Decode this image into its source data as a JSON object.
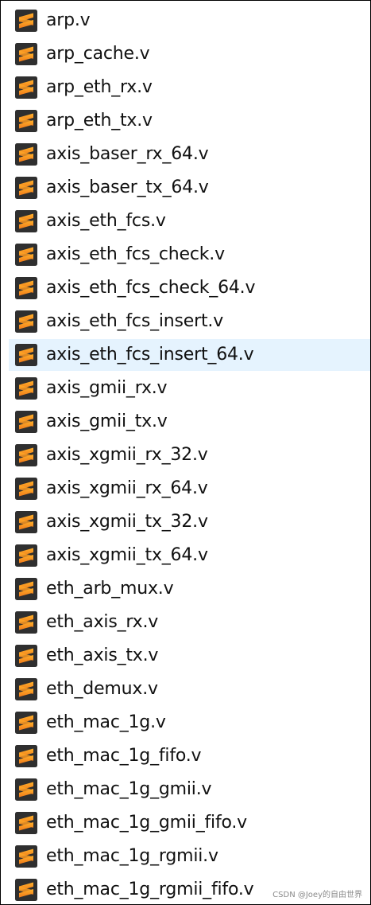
{
  "file_list": {
    "selected_index": 10,
    "icon": "sublime-text-file-icon",
    "icon_colors": {
      "tile": "#2f2f2f",
      "glyph_top": "#ffb12a",
      "glyph_bottom": "#f07a1a"
    },
    "files": [
      "arp.v",
      "arp_cache.v",
      "arp_eth_rx.v",
      "arp_eth_tx.v",
      "axis_baser_rx_64.v",
      "axis_baser_tx_64.v",
      "axis_eth_fcs.v",
      "axis_eth_fcs_check.v",
      "axis_eth_fcs_check_64.v",
      "axis_eth_fcs_insert.v",
      "axis_eth_fcs_insert_64.v",
      "axis_gmii_rx.v",
      "axis_gmii_tx.v",
      "axis_xgmii_rx_32.v",
      "axis_xgmii_rx_64.v",
      "axis_xgmii_tx_32.v",
      "axis_xgmii_tx_64.v",
      "eth_arb_mux.v",
      "eth_axis_rx.v",
      "eth_axis_tx.v",
      "eth_demux.v",
      "eth_mac_1g.v",
      "eth_mac_1g_fifo.v",
      "eth_mac_1g_gmii.v",
      "eth_mac_1g_gmii_fifo.v",
      "eth_mac_1g_rgmii.v",
      "eth_mac_1g_rgmii_fifo.v"
    ]
  },
  "watermark": "CSDN @Joey的自由世界",
  "selection_color": "#e5f3fe"
}
